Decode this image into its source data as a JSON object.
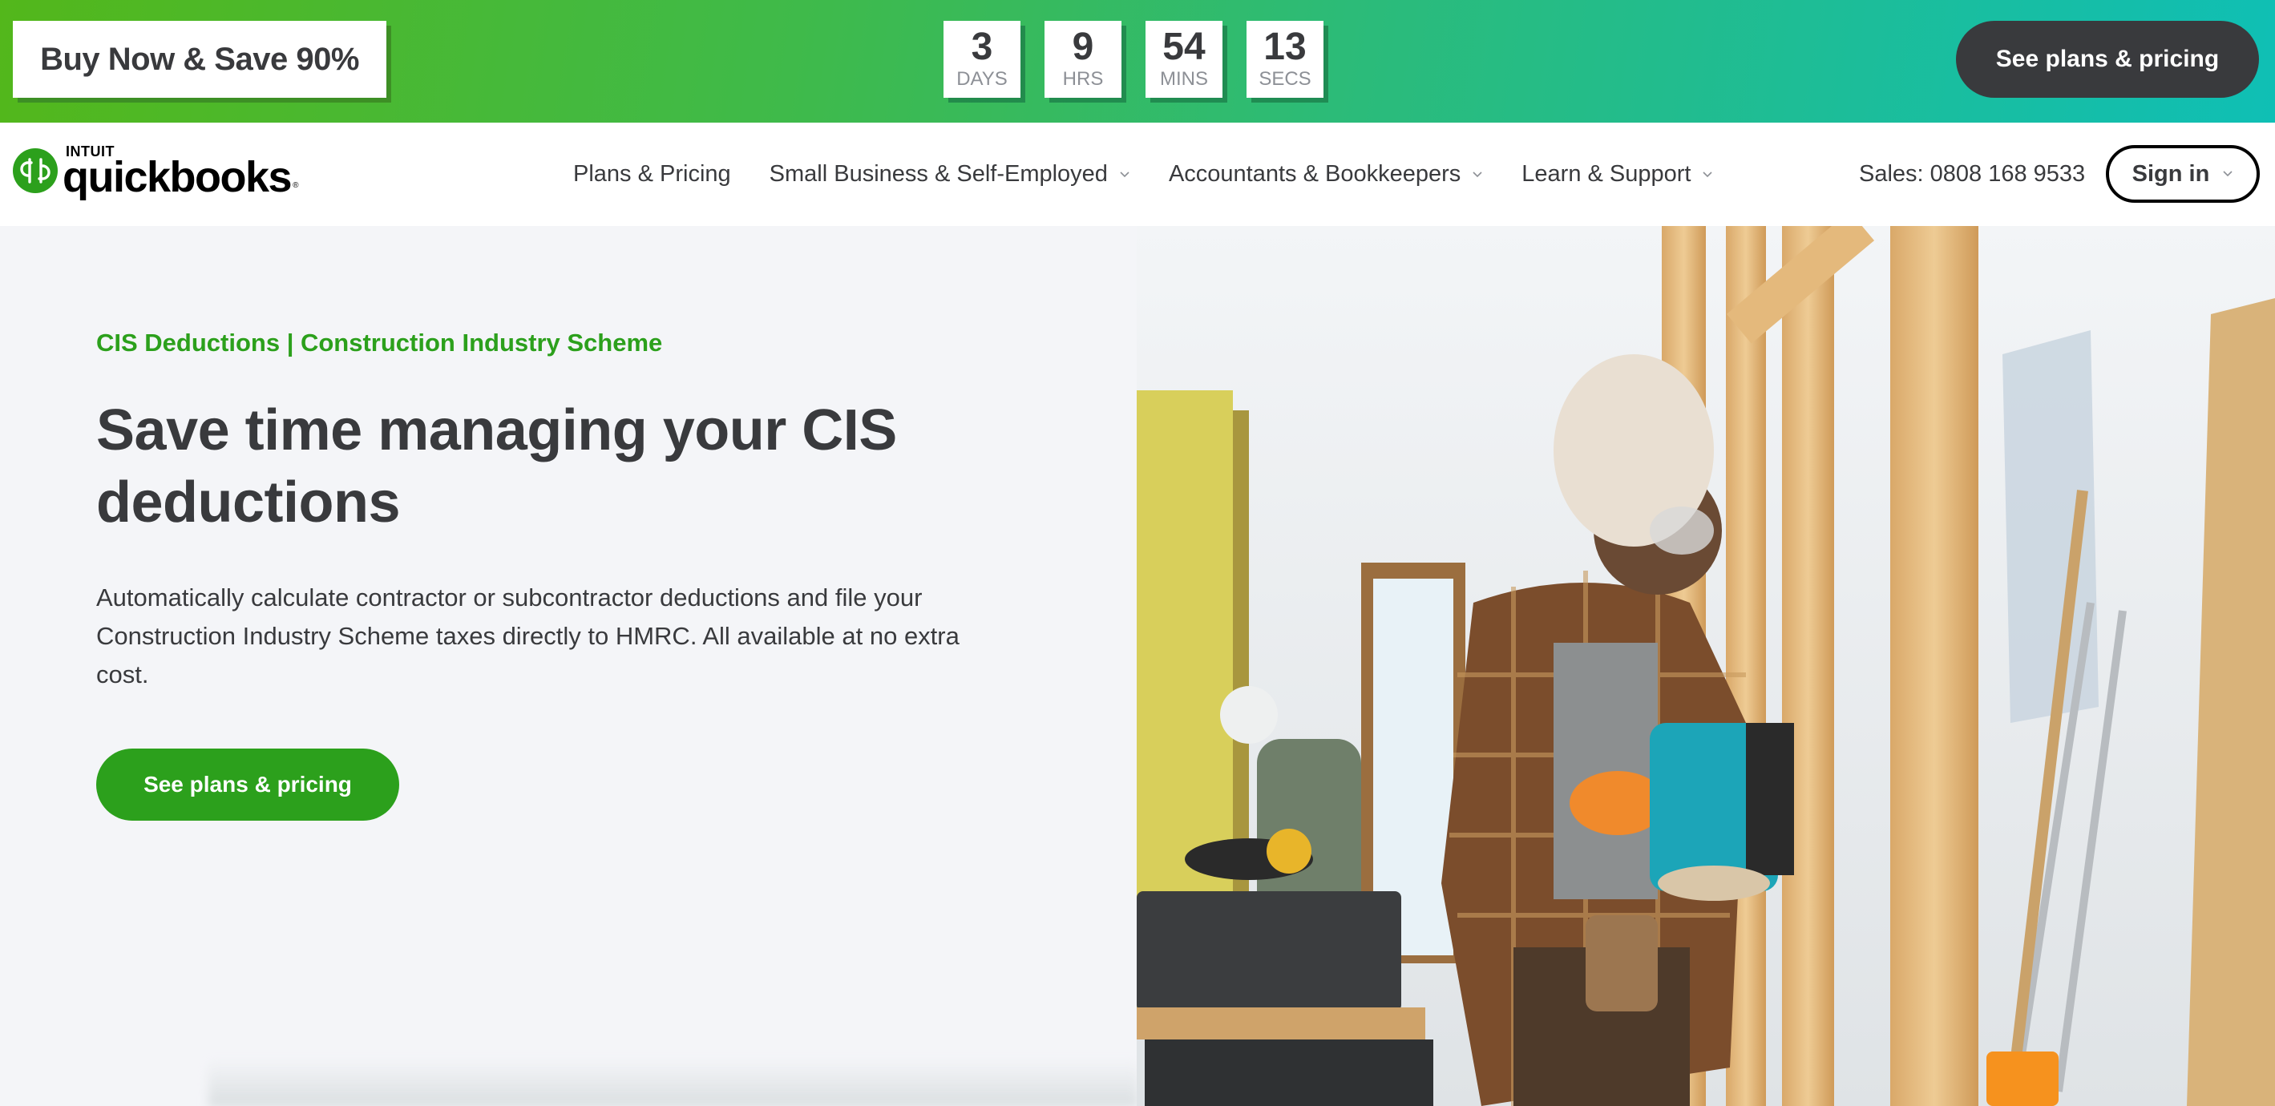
{
  "promo": {
    "badge_label": "Buy Now & Save 90%",
    "countdown": [
      {
        "value": "3",
        "unit": "DAYS"
      },
      {
        "value": "9",
        "unit": "HRS"
      },
      {
        "value": "54",
        "unit": "MINS"
      },
      {
        "value": "13",
        "unit": "SECS"
      }
    ],
    "cta_label": "See plans & pricing"
  },
  "nav": {
    "logo": {
      "intuit": "INTUIT",
      "product": "quickbooks",
      "reg": "®"
    },
    "links": [
      {
        "label": "Plans & Pricing",
        "has_dropdown": false
      },
      {
        "label": "Small Business & Self-Employed",
        "has_dropdown": true
      },
      {
        "label": "Accountants & Bookkeepers",
        "has_dropdown": true
      },
      {
        "label": "Learn & Support",
        "has_dropdown": true
      }
    ],
    "sales": "Sales: 0808 168 9533",
    "signin_label": "Sign in"
  },
  "hero": {
    "eyebrow": "CIS Deductions | Construction Industry Scheme",
    "headline": "Save time managing your CIS deductions",
    "body": "Automatically calculate contractor or subcontractor deductions and file your Construction Industry Scheme taxes directly to HMRC. All available at no extra cost.",
    "cta_label": "See plans & pricing",
    "image_alt": "Construction worker in hard hat using a nail gun on timber framing"
  },
  "colors": {
    "brand_green": "#2ca01c",
    "dark": "#393a3d",
    "bg": "#f4f5f8"
  }
}
